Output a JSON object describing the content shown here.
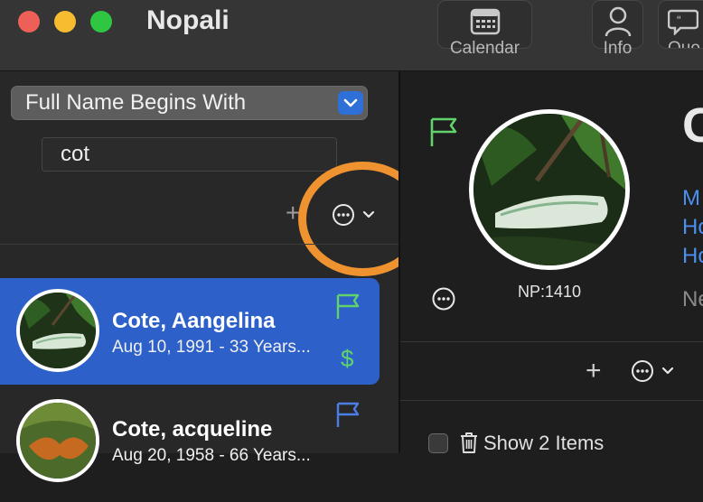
{
  "window": {
    "title": "Nopali"
  },
  "colors": {
    "accent": "#2d60c9",
    "flag_green": "#61d36a",
    "flag_blue": "#4d7ee8",
    "highlight": "#ef9330",
    "link": "#4b8ff0"
  },
  "toolbar": {
    "calendar_label": "Calendar",
    "info_label": "Info",
    "quote_label": "Quo"
  },
  "sidebar": {
    "filter_mode": "Full Name Begins With",
    "search_value": "cot",
    "add_symbol": "+",
    "records": [
      {
        "name": "Cote, Aangelina",
        "subtitle": "Aug 10, 1991 - 33 Years...",
        "flag": "green",
        "badge": "$",
        "selected": true
      },
      {
        "name": "Cote, acqueline",
        "subtitle": "Aug 20, 1958 - 66 Years...",
        "flag": "blue",
        "selected": false
      }
    ]
  },
  "detail": {
    "heading": "C",
    "np_id": "NP:1410",
    "links": [
      "M",
      "Ho",
      "Ho"
    ],
    "ne_text": "Ne",
    "add_symbol": "+",
    "show_items_label": "Show 2 Items"
  },
  "icons": [
    "calendar-icon",
    "person-icon",
    "quote-bubble-icon",
    "flag-icon",
    "ellipsis-circle-icon",
    "chevron-down-icon",
    "trash-icon",
    "checkbox"
  ]
}
